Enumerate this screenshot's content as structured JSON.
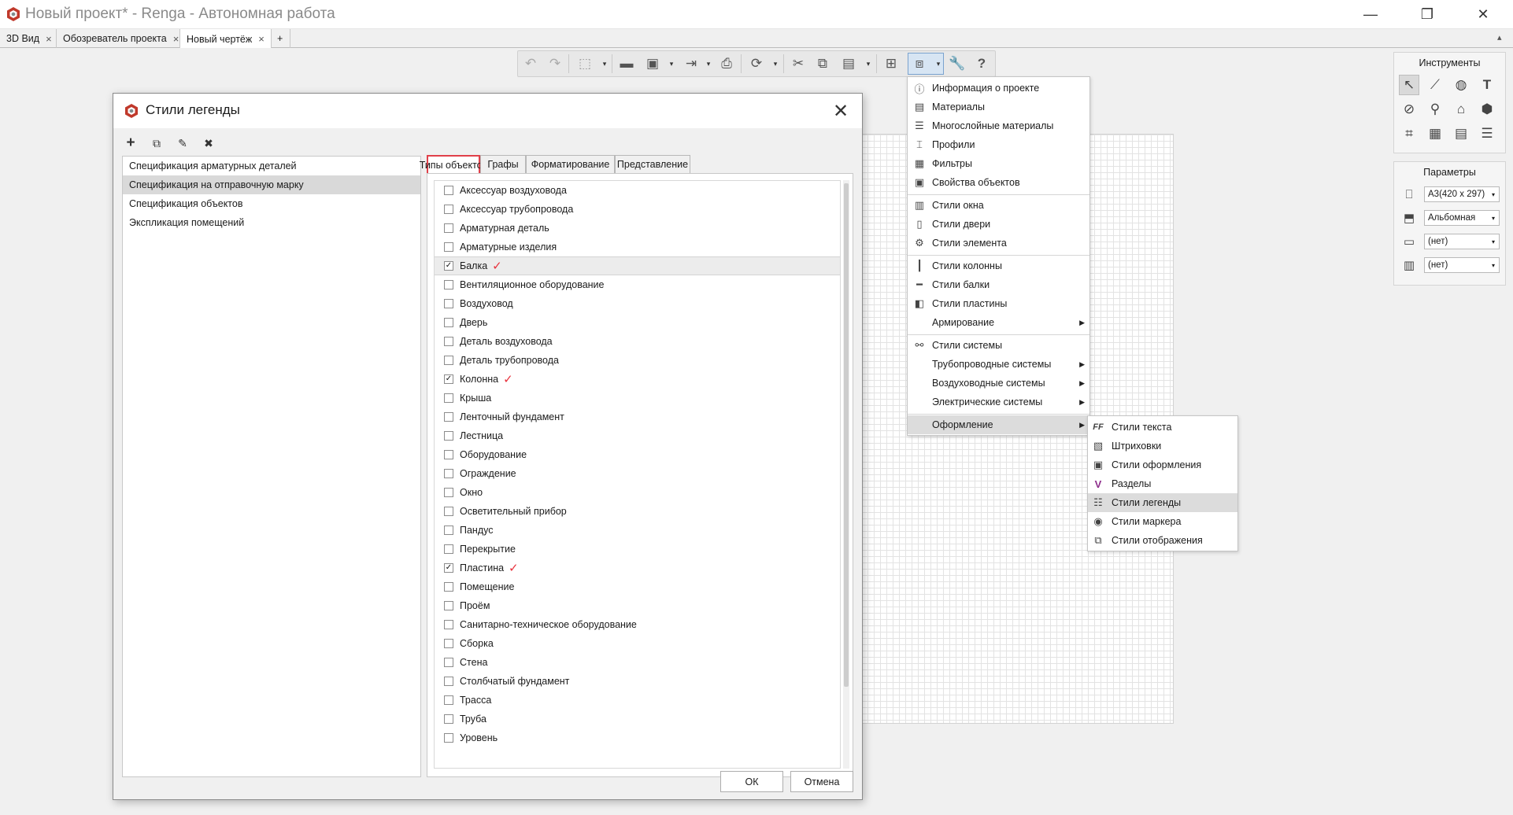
{
  "window": {
    "title": "Новый проект* - Renga - Автономная работа",
    "controls": {
      "minimize": "—",
      "restore": "❐",
      "close": "✕"
    }
  },
  "tabs": [
    {
      "label": "3D Вид",
      "close": "×"
    },
    {
      "label": "Обозреватель проекта",
      "close": "×"
    },
    {
      "label": "Новый чертёж",
      "close": "×"
    }
  ],
  "tab_add": "+",
  "panel_collapse": "▴",
  "toolbar": {
    "icons": [
      "undo-icon",
      "redo-icon",
      "3d-view-icon",
      "open-folder-icon",
      "save-icon",
      "export-icon",
      "print-icon",
      "sync-icon",
      "cut-icon",
      "copy-icon",
      "paste-icon",
      "layout-icon",
      "styles-menu-icon",
      "settings-icon",
      "help-icon"
    ],
    "dropdown_arrow": "▾"
  },
  "styles_menu": {
    "items": [
      {
        "label": "Информация о проекте",
        "icon": "project-info-icon",
        "glyph": "ⓘ"
      },
      {
        "label": "Материалы",
        "icon": "materials-icon",
        "glyph": "▤"
      },
      {
        "label": "Многослойные материалы",
        "icon": "layered-materials-icon",
        "glyph": "☰"
      },
      {
        "label": "Профили",
        "icon": "profiles-icon",
        "glyph": "⌶"
      },
      {
        "label": "Фильтры",
        "icon": "filters-icon",
        "glyph": "▦"
      },
      {
        "label": "Свойства объектов",
        "icon": "object-properties-icon",
        "glyph": "▣"
      },
      {
        "label": "Стили окна",
        "icon": "window-styles-icon",
        "glyph": "▥"
      },
      {
        "label": "Стили двери",
        "icon": "door-styles-icon",
        "glyph": "▯"
      },
      {
        "label": "Стили элемента",
        "icon": "element-styles-icon",
        "glyph": "⚙"
      },
      {
        "label": "Стили колонны",
        "icon": "column-styles-icon",
        "glyph": "┃"
      },
      {
        "label": "Стили балки",
        "icon": "beam-styles-icon",
        "glyph": "━"
      },
      {
        "label": "Стили пластины",
        "icon": "plate-styles-icon",
        "glyph": "◧"
      },
      {
        "label": "Армирование",
        "icon": "",
        "glyph": "",
        "submenu": "▶"
      },
      {
        "label": "Стили системы",
        "icon": "system-styles-icon",
        "glyph": "⚯"
      },
      {
        "label": "Трубопроводные системы",
        "icon": "",
        "glyph": "",
        "submenu": "▶"
      },
      {
        "label": "Воздуховодные системы",
        "icon": "",
        "glyph": "",
        "submenu": "▶"
      },
      {
        "label": "Электрические системы",
        "icon": "",
        "glyph": "",
        "submenu": "▶"
      },
      {
        "label": "Оформление",
        "icon": "",
        "glyph": "",
        "submenu": "▶"
      }
    ]
  },
  "design_submenu": {
    "items": [
      {
        "label": "Стили текста",
        "icon": "text-styles-icon",
        "glyph": "FF"
      },
      {
        "label": "Штриховки",
        "icon": "hatch-icon",
        "glyph": "▧"
      },
      {
        "label": "Стили оформления",
        "icon": "design-styles-icon",
        "glyph": "▣"
      },
      {
        "label": "Разделы",
        "icon": "sections-icon",
        "glyph": "V"
      },
      {
        "label": "Стили легенды",
        "icon": "legend-styles-icon",
        "glyph": "☷"
      },
      {
        "label": "Стили маркера",
        "icon": "marker-styles-icon",
        "glyph": "◉"
      },
      {
        "label": "Стили отображения",
        "icon": "display-styles-icon",
        "glyph": "⧉"
      }
    ]
  },
  "tools_panel": {
    "title": "Инструменты",
    "tools": [
      {
        "icon": "select-icon",
        "glyph": "↖"
      },
      {
        "icon": "line-icon",
        "glyph": "⟋"
      },
      {
        "icon": "hatch-tool-icon",
        "glyph": "◍"
      },
      {
        "icon": "text-tool-icon",
        "glyph": "T"
      },
      {
        "icon": "dimension-icon",
        "glyph": "⊘"
      },
      {
        "icon": "marker-tool-icon",
        "glyph": "⚲"
      },
      {
        "icon": "view-tool-icon",
        "glyph": "⌂"
      },
      {
        "icon": "3d-object-icon",
        "glyph": "⬢"
      },
      {
        "icon": "frame-tool-icon",
        "glyph": "⌗"
      },
      {
        "icon": "table-tool-icon",
        "glyph": "▦"
      },
      {
        "icon": "grid-tool-icon",
        "glyph": "▤"
      },
      {
        "icon": "legend-tool-icon",
        "glyph": "☰"
      }
    ]
  },
  "params_panel": {
    "title": "Параметры",
    "params": [
      {
        "icon": "sheet-format-icon",
        "glyph": "⎕",
        "value": "А3(420 x 297)"
      },
      {
        "icon": "orientation-icon",
        "glyph": "⬒",
        "value": "Альбомная"
      },
      {
        "icon": "frame-style-icon",
        "glyph": "▭",
        "value": "(нет)"
      },
      {
        "icon": "title-block-icon",
        "glyph": "▥",
        "value": "(нет)"
      }
    ],
    "dropdown_arrow": "▾"
  },
  "dialog": {
    "title": "Стили легенды",
    "close": "✕",
    "toolbar": [
      {
        "icon": "add-icon",
        "glyph": "+"
      },
      {
        "icon": "duplicate-icon",
        "glyph": "⧉"
      },
      {
        "icon": "rename-icon",
        "glyph": "✎"
      },
      {
        "icon": "delete-icon",
        "glyph": "✖"
      }
    ],
    "styles_list": [
      "Спецификация арматурных деталей",
      "Спецификация на отправочную марку",
      "Спецификация объектов",
      "Экспликация помещений"
    ],
    "tabs": [
      "Типы объектов",
      "Графы",
      "Форматирование",
      "Представление"
    ],
    "object_types": [
      {
        "label": "Аксессуар воздуховода",
        "checked": false
      },
      {
        "label": "Аксессуар трубопровода",
        "checked": false
      },
      {
        "label": "Арматурная деталь",
        "checked": false
      },
      {
        "label": "Арматурные изделия",
        "checked": false
      },
      {
        "label": "Балка",
        "checked": true
      },
      {
        "label": "Вентиляционное оборудование",
        "checked": false
      },
      {
        "label": "Воздуховод",
        "checked": false
      },
      {
        "label": "Дверь",
        "checked": false
      },
      {
        "label": "Деталь воздуховода",
        "checked": false
      },
      {
        "label": "Деталь трубопровода",
        "checked": false
      },
      {
        "label": "Колонна",
        "checked": true
      },
      {
        "label": "Крыша",
        "checked": false
      },
      {
        "label": "Ленточный фундамент",
        "checked": false
      },
      {
        "label": "Лестница",
        "checked": false
      },
      {
        "label": "Оборудование",
        "checked": false
      },
      {
        "label": "Ограждение",
        "checked": false
      },
      {
        "label": "Окно",
        "checked": false
      },
      {
        "label": "Осветительный прибор",
        "checked": false
      },
      {
        "label": "Пандус",
        "checked": false
      },
      {
        "label": "Перекрытие",
        "checked": false
      },
      {
        "label": "Пластина",
        "checked": true
      },
      {
        "label": "Помещение",
        "checked": false
      },
      {
        "label": "Проём",
        "checked": false
      },
      {
        "label": "Санитарно-техническое оборудование",
        "checked": false
      },
      {
        "label": "Сборка",
        "checked": false
      },
      {
        "label": "Стена",
        "checked": false
      },
      {
        "label": "Столбчатый фундамент",
        "checked": false
      },
      {
        "label": "Трасса",
        "checked": false
      },
      {
        "label": "Труба",
        "checked": false
      },
      {
        "label": "Уровень",
        "checked": false
      }
    ],
    "check_glyph": "✓",
    "annotation_glyph": "✓",
    "ok": "ОК",
    "cancel": "Отмена"
  },
  "colors": {
    "accent_red": "#e0404a",
    "menu_selected": "#dcdcdc",
    "list_selected": "#d9d9d9"
  }
}
